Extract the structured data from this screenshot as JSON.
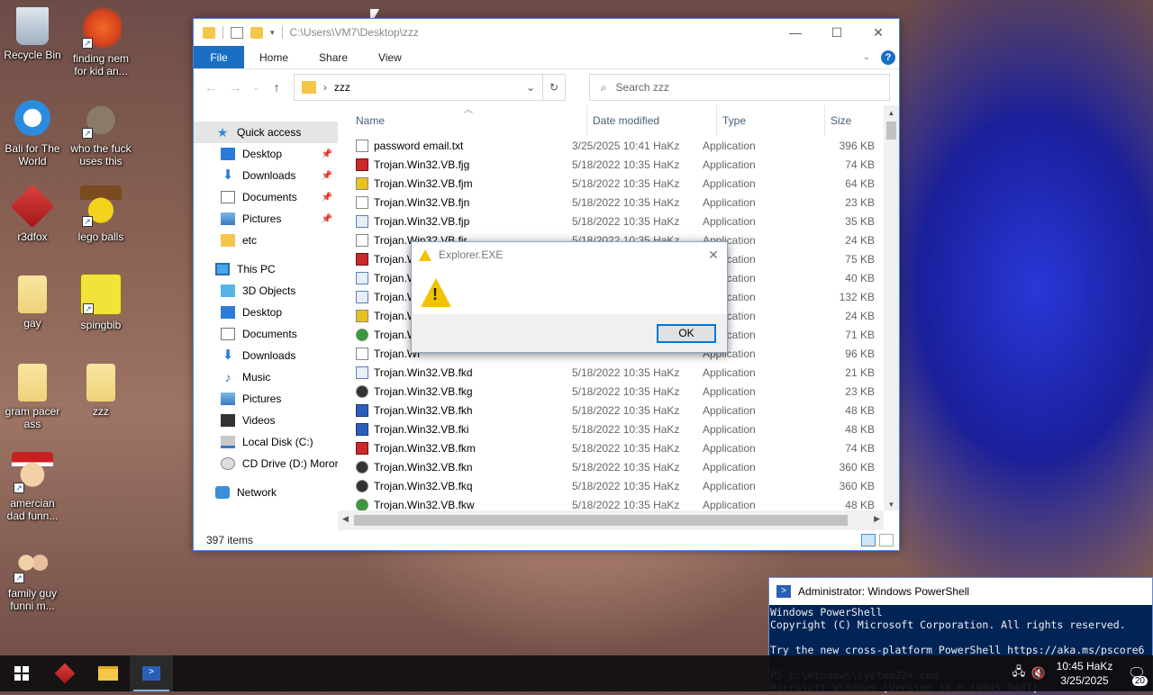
{
  "desktop": {
    "icons": [
      {
        "label": "Recycle Bin",
        "icon": "recycle-bin-icon"
      },
      {
        "label": "finding nem for kid an...",
        "icon": "fish-icon"
      },
      {
        "label": "Bali for The World",
        "icon": "ie-icon"
      },
      {
        "label": "who the fuck uses this",
        "icon": "gimp-icon"
      },
      {
        "label": "r3dfox",
        "icon": "r3dfox-icon"
      },
      {
        "label": "lego balls",
        "icon": "lego-icon"
      },
      {
        "label": "gay",
        "icon": "folder-icon"
      },
      {
        "label": "spingbib",
        "icon": "spongebob-icon"
      },
      {
        "label": "gram pacer ass",
        "icon": "folder-icon"
      },
      {
        "label": "zzz",
        "icon": "folder-icon"
      },
      {
        "label": "amercian dad funn...",
        "icon": "cartoon-icon"
      },
      {
        "label": "family guy funni m...",
        "icon": "cartoon-icon"
      }
    ]
  },
  "explorer": {
    "path": "C:\\Users\\VM7\\Desktop\\zzz",
    "ribbon_tabs": [
      "File",
      "Home",
      "Share",
      "View"
    ],
    "address_folder": "zzz",
    "search_placeholder": "Search zzz",
    "nav": {
      "quick_access": "Quick access",
      "quick_items": [
        "Desktop",
        "Downloads",
        "Documents",
        "Pictures",
        "etc"
      ],
      "this_pc": "This PC",
      "pc_items": [
        "3D Objects",
        "Desktop",
        "Documents",
        "Downloads",
        "Music",
        "Pictures",
        "Videos",
        "Local Disk (C:)",
        "CD Drive (D:) Moror"
      ],
      "network": "Network"
    },
    "columns": {
      "name": "Name",
      "date": "Date modified",
      "type": "Type",
      "size": "Size"
    },
    "files": [
      {
        "name": "password email.txt",
        "date": "3/25/2025 10:41 HaKz",
        "type": "Application",
        "size": "396 KB",
        "icon": "txt"
      },
      {
        "name": "Trojan.Win32.VB.fjg",
        "date": "5/18/2022 10:35 HaKz",
        "type": "Application",
        "size": "74 KB",
        "icon": "red"
      },
      {
        "name": "Trojan.Win32.VB.fjm",
        "date": "5/18/2022 10:35 HaKz",
        "type": "Application",
        "size": "64 KB",
        "icon": "yellow"
      },
      {
        "name": "Trojan.Win32.VB.fjn",
        "date": "5/18/2022 10:35 HaKz",
        "type": "Application",
        "size": "23 KB",
        "icon": "txt"
      },
      {
        "name": "Trojan.Win32.VB.fjp",
        "date": "5/18/2022 10:35 HaKz",
        "type": "Application",
        "size": "35 KB",
        "icon": "app"
      },
      {
        "name": "Trojan.Win32.VB.fjr",
        "date": "5/18/2022 10:35 HaKz",
        "type": "Application",
        "size": "24 KB",
        "icon": "txt"
      },
      {
        "name": "Trojan.Wi",
        "date": "",
        "type": "Application",
        "size": "75 KB",
        "icon": "red"
      },
      {
        "name": "Trojan.W",
        "date": "",
        "type": "Application",
        "size": "40 KB",
        "icon": "app"
      },
      {
        "name": "Trojan.Wi",
        "date": "",
        "type": "Application",
        "size": "132 KB",
        "icon": "app"
      },
      {
        "name": "Trojan.Wi",
        "date": "",
        "type": "Application",
        "size": "24 KB",
        "icon": "yellow"
      },
      {
        "name": "Trojan.Wi",
        "date": "",
        "type": "Application",
        "size": "71 KB",
        "icon": "green"
      },
      {
        "name": "Trojan.Wi",
        "date": "",
        "type": "Application",
        "size": "96 KB",
        "icon": "txt"
      },
      {
        "name": "Trojan.Win32.VB.fkd",
        "date": "5/18/2022 10:35 HaKz",
        "type": "Application",
        "size": "21 KB",
        "icon": "app"
      },
      {
        "name": "Trojan.Win32.VB.fkg",
        "date": "5/18/2022 10:35 HaKz",
        "type": "Application",
        "size": "23 KB",
        "icon": "face"
      },
      {
        "name": "Trojan.Win32.VB.fkh",
        "date": "5/18/2022 10:35 HaKz",
        "type": "Application",
        "size": "48 KB",
        "icon": "doc"
      },
      {
        "name": "Trojan.Win32.VB.fki",
        "date": "5/18/2022 10:35 HaKz",
        "type": "Application",
        "size": "48 KB",
        "icon": "doc"
      },
      {
        "name": "Trojan.Win32.VB.fkm",
        "date": "5/18/2022 10:35 HaKz",
        "type": "Application",
        "size": "74 KB",
        "icon": "red"
      },
      {
        "name": "Trojan.Win32.VB.fkn",
        "date": "5/18/2022 10:35 HaKz",
        "type": "Application",
        "size": "360 KB",
        "icon": "face"
      },
      {
        "name": "Trojan.Win32.VB.fkq",
        "date": "5/18/2022 10:35 HaKz",
        "type": "Application",
        "size": "360 KB",
        "icon": "face"
      },
      {
        "name": "Trojan.Win32.VB.fkw",
        "date": "5/18/2022 10:35 HaKz",
        "type": "Application",
        "size": "48 KB",
        "icon": "green"
      }
    ],
    "status": "397 items"
  },
  "dialog": {
    "title": "Explorer.EXE",
    "ok_label": "OK"
  },
  "powershell": {
    "title": "Administrator: Windows PowerShell",
    "lines": [
      "Windows PowerShell",
      "Copyright (C) Microsoft Corporation. All rights reserved.",
      "",
      "Try the new cross-platform PowerShell https://aka.ms/pscore6",
      "",
      "PS C:\\Windows\\system32> cmd",
      "Microsoft Windows [Version 10.0.19045.5487]"
    ]
  },
  "taskbar": {
    "time": "10:45 HaKz",
    "date": "3/25/2025",
    "notification_count": "20"
  },
  "colors": {
    "accent": "#1a6fc5",
    "powershell_bg": "#012456",
    "warning": "#f2c200"
  }
}
